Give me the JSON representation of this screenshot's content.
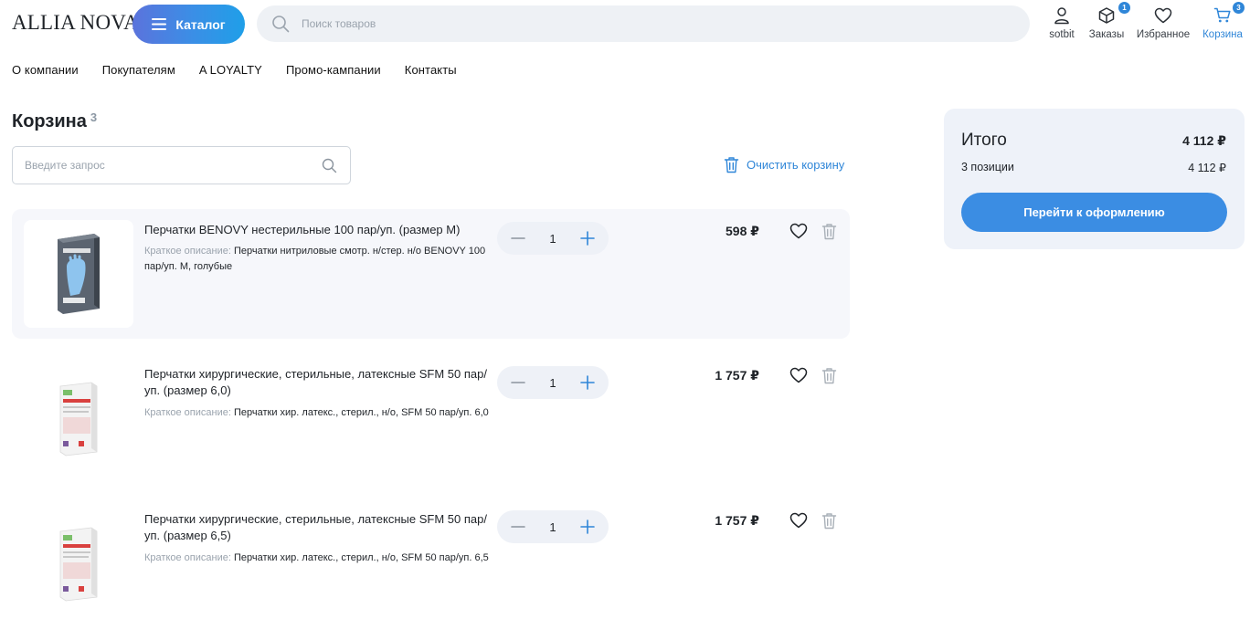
{
  "header": {
    "logo": "ALLIA NOVA",
    "catalog_label": "Каталог",
    "search_placeholder": "Поиск товаров",
    "actions": {
      "profile": {
        "label": "sotbit",
        "icon": "user-icon"
      },
      "orders": {
        "label": "Заказы",
        "icon": "box-icon",
        "badge": "1"
      },
      "favorites": {
        "label": "Избранное",
        "icon": "heart-icon"
      },
      "cart": {
        "label": "Корзина",
        "icon": "cart-icon",
        "badge": "3"
      }
    },
    "accent_color": "#2f86d8"
  },
  "nav": [
    "О компании",
    "Покупателям",
    "A LOYALTY",
    "Промо-кампании",
    "Контакты"
  ],
  "basket": {
    "title": "Корзина",
    "count": "3",
    "search_placeholder": "Введите запрос",
    "clear_label": "Очистить корзину",
    "desc_label": "Краткое описание:",
    "items": [
      {
        "name": "Перчатки BENOVY нестерильные 100 пар/уп. (размер M)",
        "desc": "Перчатки нитриловые смотр. н/стер. н/о BENOVY 100 пар/уп. M, голубые",
        "qty": "1",
        "price": "598 ₽"
      },
      {
        "name": "Перчатки хирургические, стерильные, латексные SFM 50 пар/уп. (размер 6,0)",
        "desc": "Перчатки хир. латекс., стерил., н/о, SFM 50 пар/уп. 6,0",
        "qty": "1",
        "price": "1 757 ₽"
      },
      {
        "name": "Перчатки хирургические, стерильные, латексные SFM 50 пар/уп. (размер 6,5)",
        "desc": "Перчатки хир. латекс., стерил., н/о, SFM 50 пар/уп. 6,5",
        "qty": "1",
        "price": "1 757 ₽"
      }
    ]
  },
  "summary": {
    "title": "Итого",
    "total": "4 112 ₽",
    "positions_label": "3 позиции",
    "positions_value": "4 112 ₽",
    "checkout_label": "Перейти к оформлению"
  }
}
